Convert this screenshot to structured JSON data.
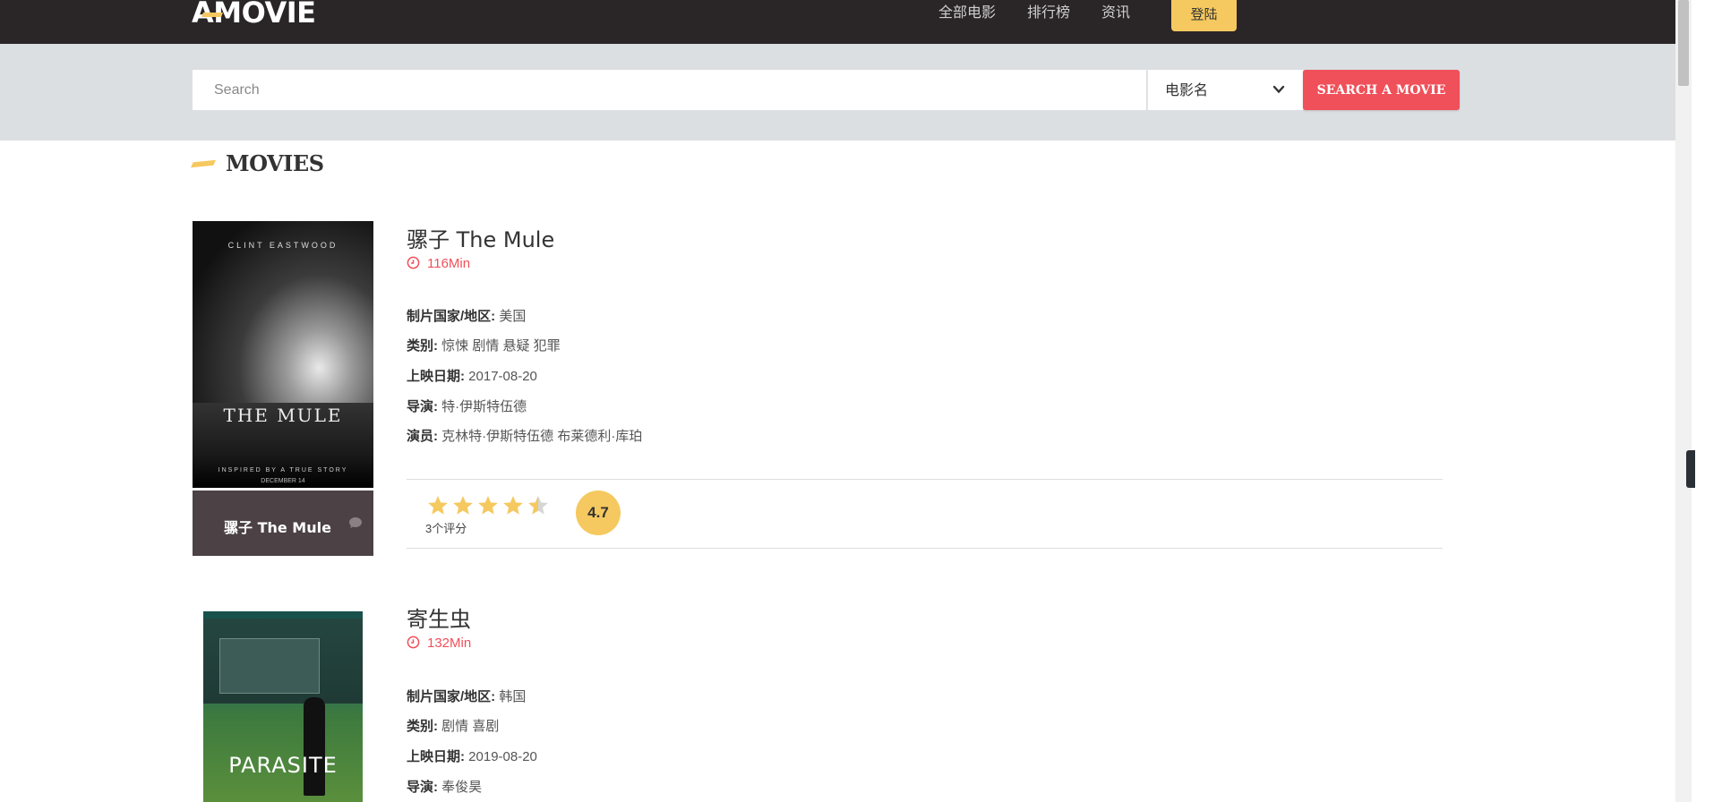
{
  "header": {
    "logo": "A-MOVIE",
    "logo_letter": "A",
    "logo_rest": "MOVIE",
    "nav": [
      "全部电影",
      "排行榜",
      "资讯"
    ],
    "login_label": "登陆"
  },
  "search": {
    "placeholder": "Search",
    "select_value": "电影名",
    "button_label": "SEARCH A MOVIE"
  },
  "section": {
    "title": "MOVIES"
  },
  "labels": {
    "country": "制片国家/地区:",
    "genre": "类别:",
    "release": "上映日期:",
    "director": "导演:",
    "cast": "演员:"
  },
  "movies": [
    {
      "title": "骡子 The Mule",
      "runtime": "116Min",
      "country": "美国",
      "genre": "惊悚 剧情 悬疑 犯罪",
      "release": "2017-08-20",
      "director": "特·伊斯特伍德",
      "cast": "克林特·伊斯特伍德 布莱德利·库珀",
      "poster_caption": "骡子 The Mule",
      "poster_text": {
        "credit": "CLINT EASTWOOD",
        "title": "THE MULE",
        "tagline": "INSPIRED BY A TRUE STORY",
        "date": "DECEMBER 14"
      },
      "rating": 4.5,
      "score": "4.7",
      "reviews": "3个评分"
    },
    {
      "title": "寄生虫",
      "runtime": "132Min",
      "country": "韩国",
      "genre": "剧情 喜剧",
      "release": "2019-08-20",
      "director": "奉俊昊",
      "poster_text": {
        "title": "PARASITE"
      }
    }
  ],
  "colors": {
    "topbar": "#2a2527",
    "accent_yellow": "#f5c95f",
    "accent_red": "#f0505a",
    "search_band": "#dcdfe2",
    "caption_bg": "#4c4145"
  }
}
